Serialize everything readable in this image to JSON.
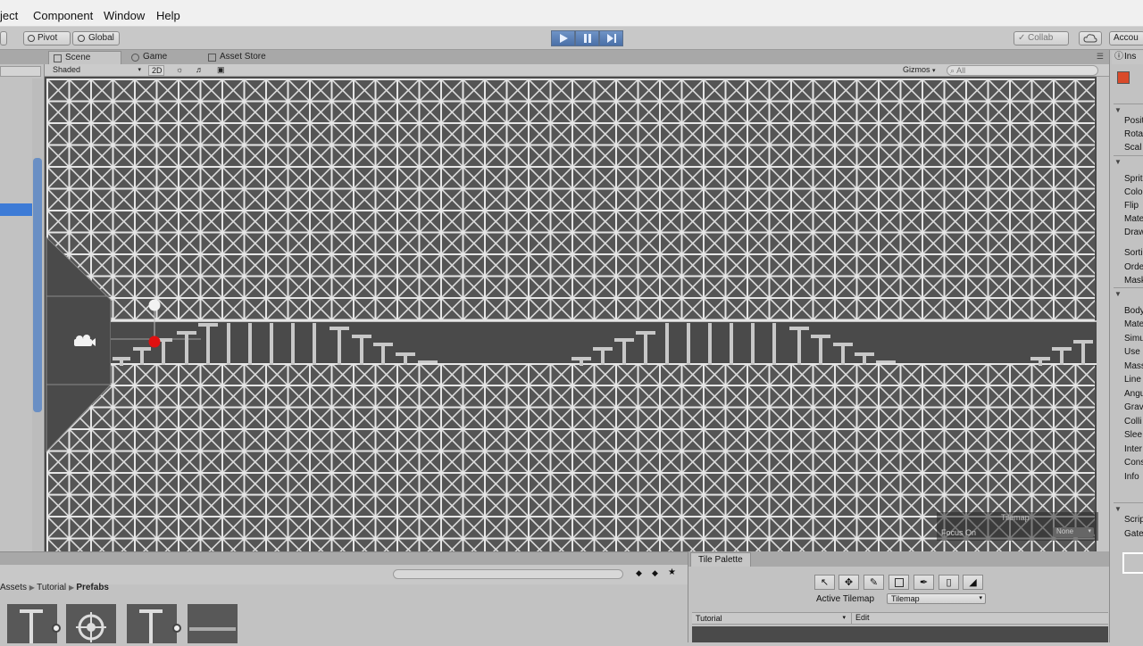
{
  "menu": {
    "items": [
      "ject",
      "Component",
      "Window",
      "Help"
    ]
  },
  "toolbar": {
    "pivot_label": "Pivot",
    "global_label": "Global",
    "collab_label": "Collab",
    "account_label": "Accou"
  },
  "scene": {
    "tabs": [
      "Scene",
      "Game",
      "Asset Store"
    ],
    "shading_mode": "Shaded",
    "mode_2d": "2D",
    "gizmos_label": "Gizmos",
    "search_placeholder": "All"
  },
  "tilemap_overlay": {
    "title": "Tilemap",
    "focus_label": "Focus On",
    "focus_value": "None"
  },
  "project": {
    "breadcrumb": [
      "Assets",
      "Tutorial",
      "Prefabs"
    ]
  },
  "tile_palette": {
    "tab_label": "Tile Palette",
    "active_tilemap_label": "Active Tilemap",
    "active_tilemap_value": "Tilemap",
    "palette_value": "Tutorial",
    "edit_label": "Edit"
  },
  "inspector": {
    "title": "Ins",
    "fields": [
      "Posit",
      "Rota",
      "Scal",
      "Sprit",
      "Colo",
      "Flip",
      "Mate",
      "Draw",
      "Sorti",
      "Orde",
      "Mask",
      "Body",
      "Mate",
      "Simu",
      "Use",
      "Mass",
      "Line",
      "Angu",
      "Grav",
      "Colli",
      "Slee",
      "Inter",
      "Cons",
      "Info",
      "Scrip",
      "Gate"
    ]
  }
}
